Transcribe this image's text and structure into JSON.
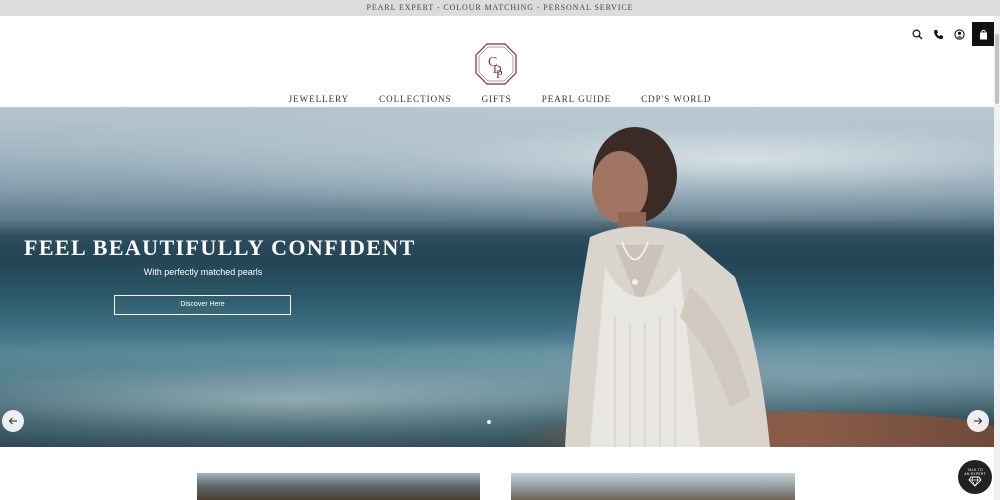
{
  "announcement": "PEARL EXPERT - COLOUR MATCHING - PERSONAL SERVICE",
  "header": {
    "logo_icon": "cdp-monogram-logo",
    "icons": [
      "search-icon",
      "phone-icon",
      "account-icon",
      "shopping-bag-icon"
    ]
  },
  "nav": {
    "items": [
      "JEWELLERY",
      "COLLECTIONS",
      "GIFTS",
      "PEARL GUIDE",
      "CDP'S WORLD"
    ]
  },
  "hero": {
    "title": "FEEL BEAUTIFULLY CONFIDENT",
    "subtitle": "With perfectly matched pearls",
    "button_label": "Discover Here",
    "prev_icon": "arrow-left-icon",
    "next_icon": "arrow-right-icon"
  },
  "expert_badge": {
    "label_line1": "TALK TO",
    "label_line2": "AN EXPERT",
    "icon": "diamond-icon"
  },
  "colors": {
    "topbar_bg": "#dcdcdc",
    "accent_dark": "#111111",
    "logo_brown": "#6b3a34"
  }
}
